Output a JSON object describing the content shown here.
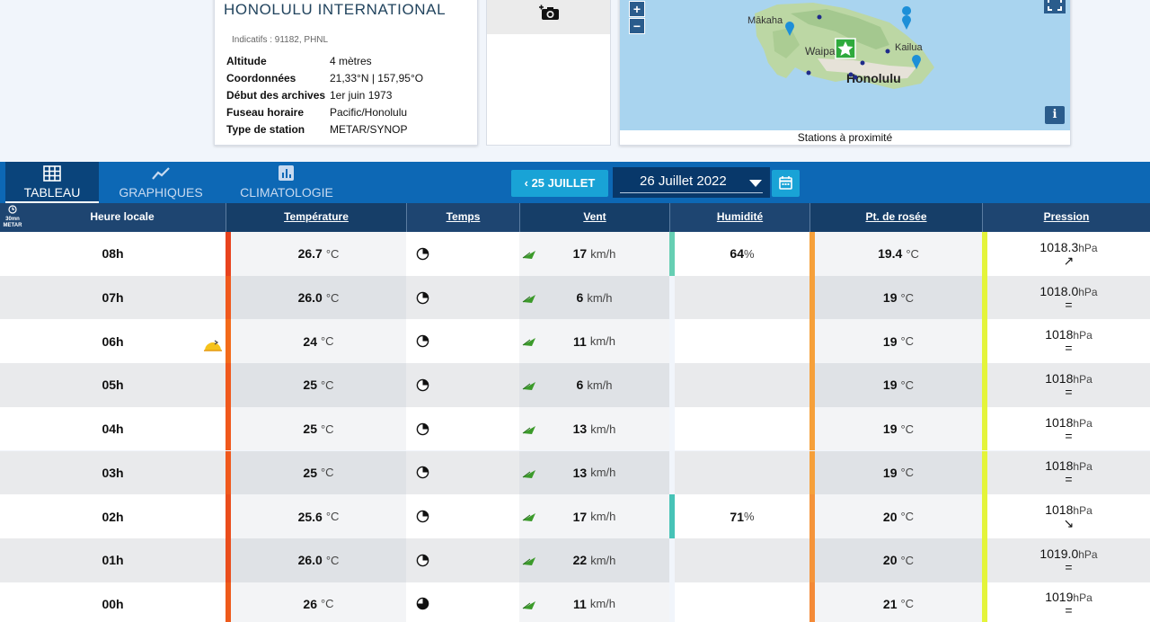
{
  "station": {
    "name": "HONOLULU INTERNATIONAL",
    "codes": "Indicatifs : 91182, PHNL",
    "info": [
      {
        "label": "Altitude",
        "value": "4 mètres"
      },
      {
        "label": "Coordonnées",
        "value": "21,33°N | 157,95°O"
      },
      {
        "label": "Début des archives",
        "value": "1er juin 1973"
      },
      {
        "label": "Fuseau horaire",
        "value": "Pacific/Honolulu"
      },
      {
        "label": "Type de station",
        "value": "METAR/SYNOP"
      }
    ]
  },
  "map": {
    "caption": "Stations à proximité",
    "zoom_in": "+",
    "zoom_out": "−",
    "info": "i",
    "labels": {
      "makaha": "Mākaha",
      "waipa": "Waipa",
      "kailua": "Kailua",
      "honolulu": "Honolulu"
    },
    "colors": {
      "sea": "#a9d4ef",
      "land": "#b9d6a0",
      "marker": "#2eaa3c"
    }
  },
  "nav": {
    "tabs": [
      {
        "label": "TABLEAU",
        "icon": "grid-icon",
        "active": true
      },
      {
        "label": "GRAPHIQUES",
        "icon": "line-chart-icon",
        "active": false
      },
      {
        "label": "CLIMATOLOGIE",
        "icon": "bar-chart-icon",
        "active": false
      }
    ],
    "prev_day": "25 JUILLET",
    "current_date": "26 Juillet 2022"
  },
  "table": {
    "badge_top": "30mn",
    "badge_bottom": "METAR",
    "headers": {
      "heure": "Heure locale",
      "temperature": "Température",
      "temps": "Temps",
      "vent": "Vent",
      "humidite": "Humidité",
      "rosee": "Pt. de rosée",
      "pression": "Pression"
    },
    "units": {
      "temp": "°C",
      "wind": "km/h",
      "hum": "%",
      "press": "hPa"
    },
    "rows": [
      {
        "hour": "08h",
        "temp": "26.7",
        "wind": "17",
        "hum": "64",
        "dew": "19.4",
        "press": "1018.3",
        "trend": "↗"
      },
      {
        "hour": "07h",
        "temp": "26.0",
        "wind": "6",
        "hum": "",
        "dew": "19",
        "press": "1018.0",
        "trend": "="
      },
      {
        "hour": "06h",
        "temp": "24",
        "wind": "11",
        "hum": "",
        "dew": "19",
        "press": "1018",
        "trend": "="
      },
      {
        "hour": "05h",
        "temp": "25",
        "wind": "6",
        "hum": "",
        "dew": "19",
        "press": "1018",
        "trend": "="
      },
      {
        "hour": "04h",
        "temp": "25",
        "wind": "13",
        "hum": "",
        "dew": "19",
        "press": "1018",
        "trend": "="
      },
      {
        "hour": "03h",
        "temp": "25",
        "wind": "13",
        "hum": "",
        "dew": "19",
        "press": "1018",
        "trend": "="
      },
      {
        "hour": "02h",
        "temp": "25.6",
        "wind": "17",
        "hum": "71",
        "dew": "20",
        "press": "1018",
        "trend": "↘"
      },
      {
        "hour": "01h",
        "temp": "26.0",
        "wind": "22",
        "hum": "",
        "dew": "20",
        "press": "1019.0",
        "trend": "="
      },
      {
        "hour": "00h",
        "temp": "26",
        "wind": "11",
        "hum": "",
        "dew": "21",
        "press": "1019",
        "trend": "="
      }
    ]
  }
}
